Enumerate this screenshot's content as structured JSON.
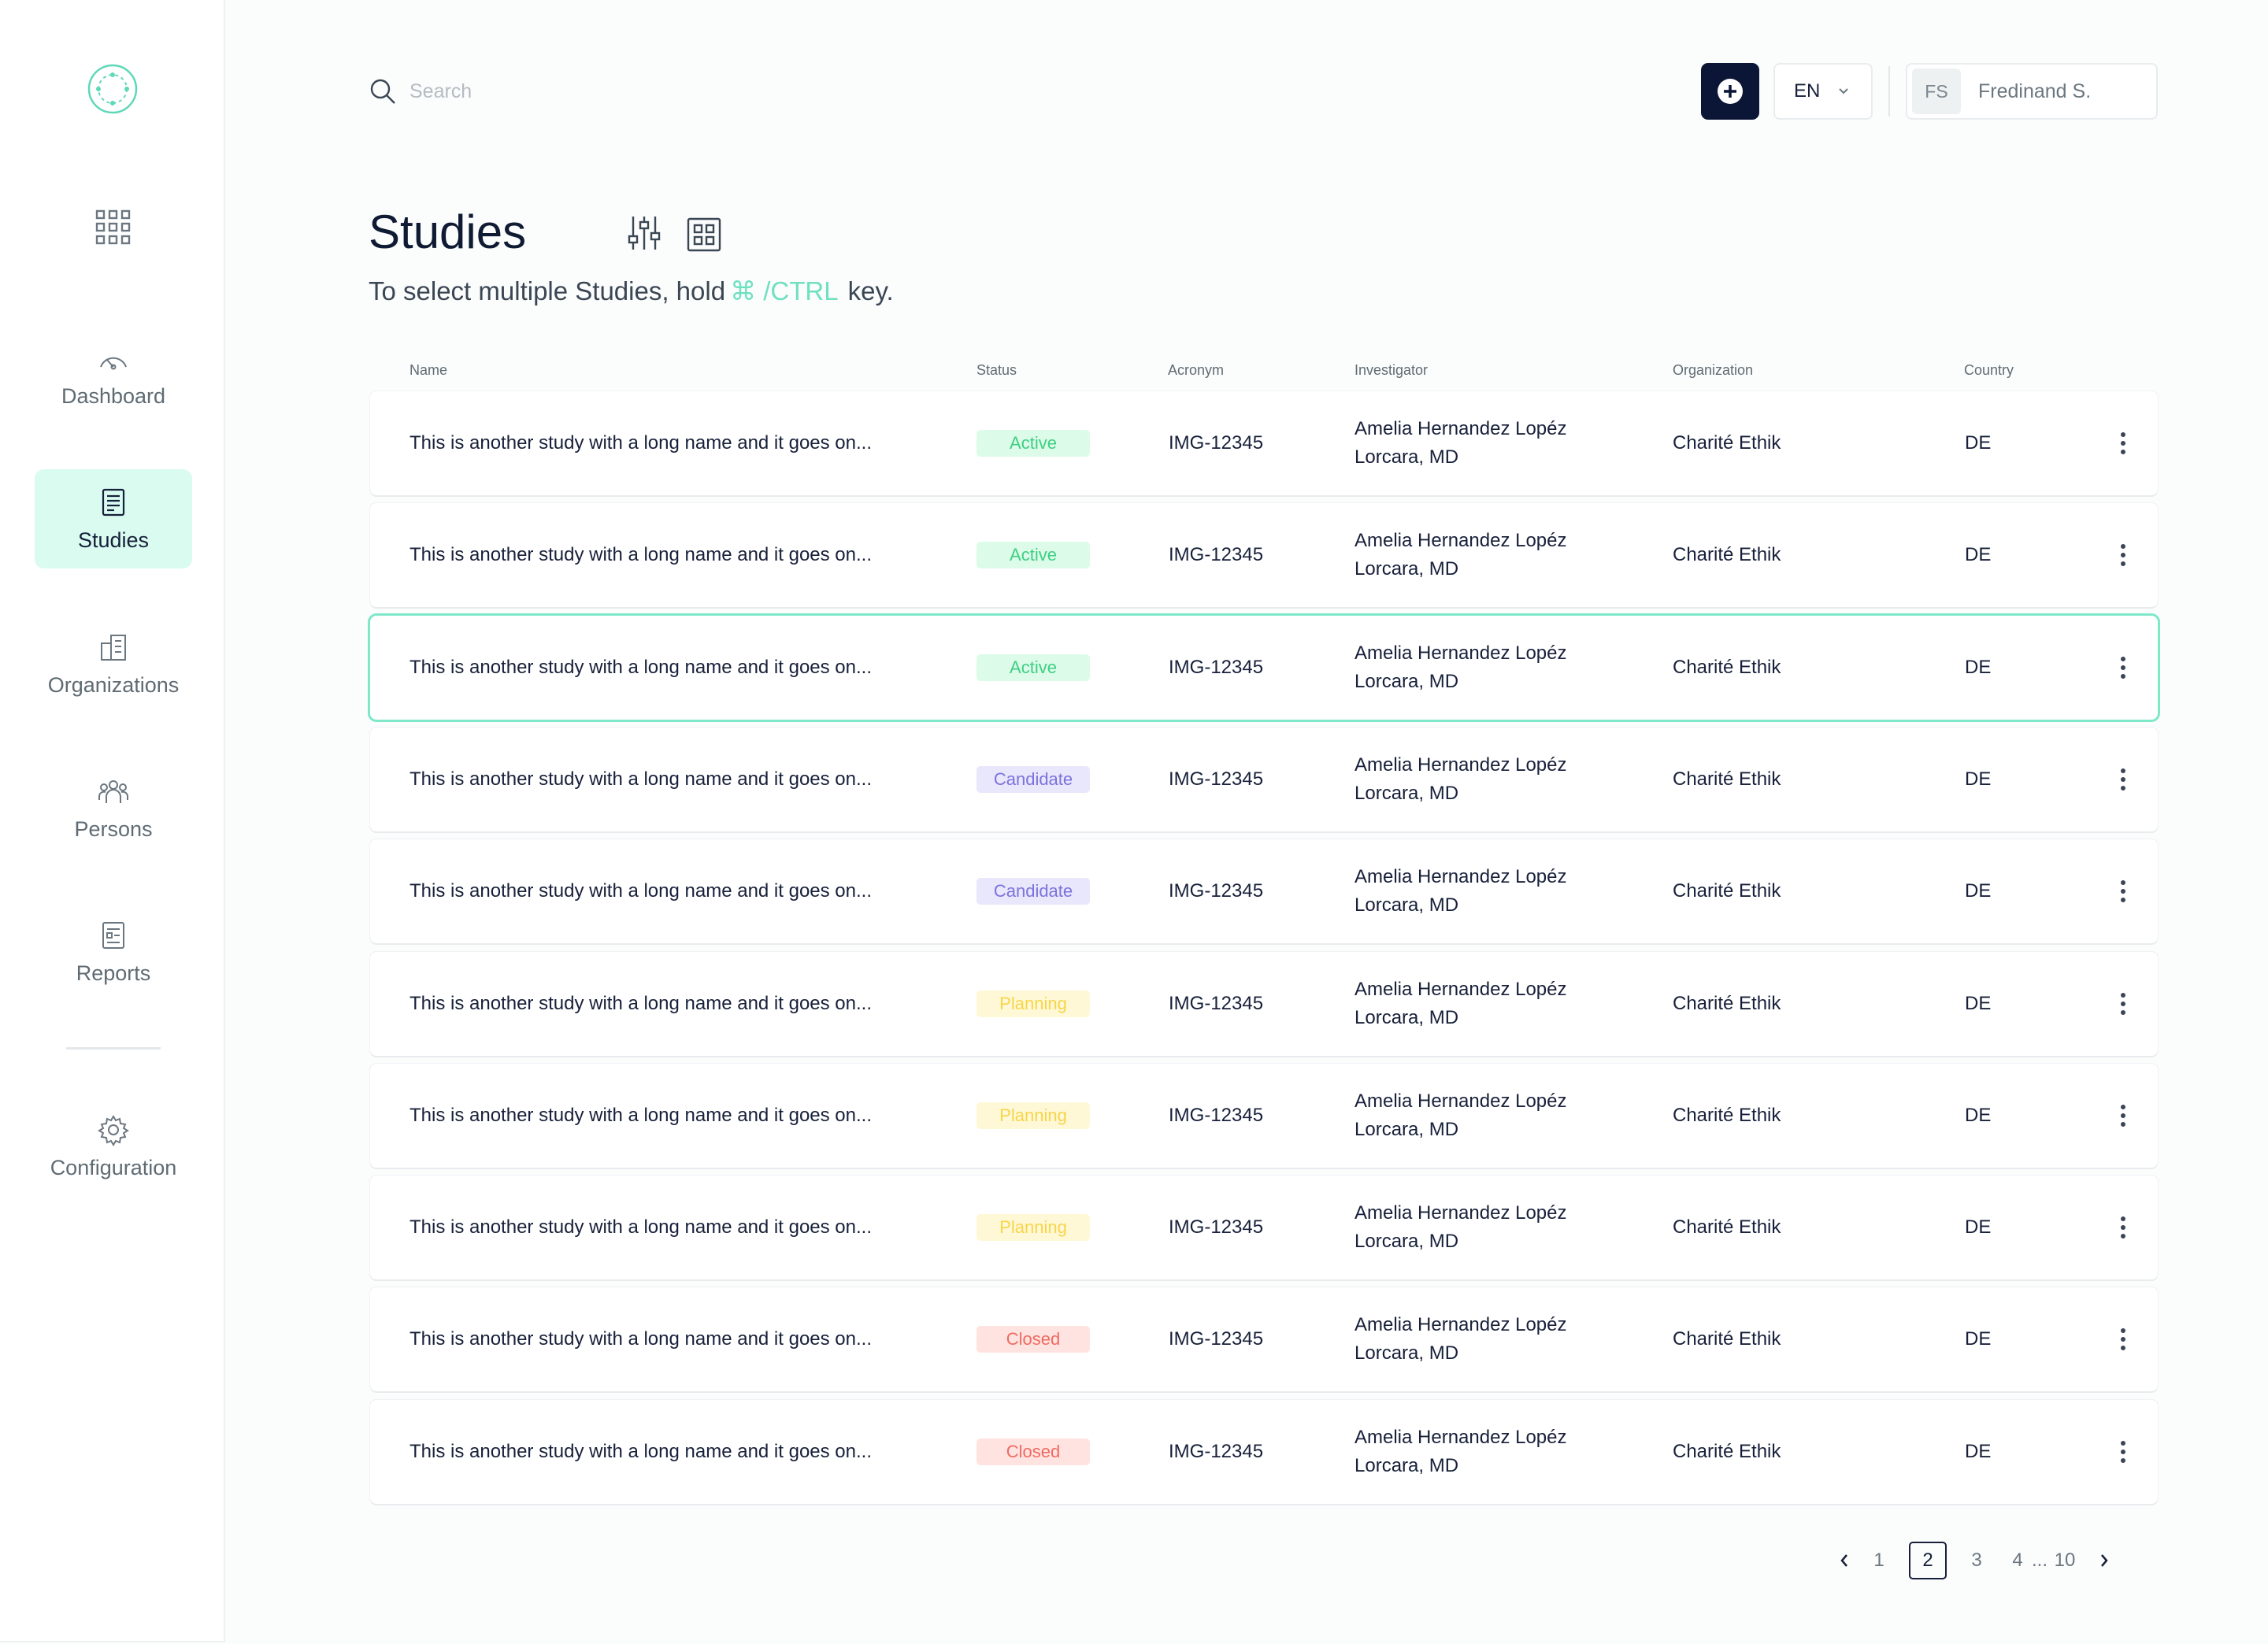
{
  "colors": {
    "accent": "#6fe0c0",
    "nav_active_bg": "#d9fbf0",
    "primary_dark": "#0b1535",
    "selected_border": "#7ee8c8"
  },
  "sidebar": {
    "logo_icon": "circular-network-icon",
    "apps_icon": "grid-dots-icon",
    "items": [
      {
        "label": "Dashboard",
        "icon": "gauge-icon",
        "active": false
      },
      {
        "label": "Studies",
        "icon": "document-icon",
        "active": true
      },
      {
        "label": "Organizations",
        "icon": "building-icon",
        "active": false
      },
      {
        "label": "Persons",
        "icon": "people-icon",
        "active": false
      },
      {
        "label": "Reports",
        "icon": "report-icon",
        "active": false
      },
      {
        "label": "Configuration",
        "icon": "gear-icon",
        "active": false
      }
    ]
  },
  "header": {
    "search_placeholder": "Search",
    "language": "EN",
    "user_initials": "FS",
    "user_name": "Fredinand S."
  },
  "page": {
    "title": "Studies",
    "hint_prefix": "To select multiple Studies, hold",
    "hint_key": "⌘ /CTRL",
    "hint_suffix": "key."
  },
  "table": {
    "columns": [
      "Name",
      "Status",
      "Acronym",
      "Investigator",
      "Organization",
      "Country"
    ],
    "status_styles": {
      "Active": {
        "bg": "#dcfbe9",
        "fg": "#3fcf84"
      },
      "Candidate": {
        "bg": "#e8e7fb",
        "fg": "#7b73dd"
      },
      "Planning": {
        "bg": "#fff8d6",
        "fg": "#f7d54a"
      },
      "Closed": {
        "bg": "#ffe3e1",
        "fg": "#ef6b61"
      }
    },
    "rows": [
      {
        "name": "This is another study with a long name and it goes on...",
        "status": "Active",
        "acronym": "IMG-12345",
        "investigator_line1": "Amelia Hernandez Lopéz",
        "investigator_line2": "Lorcara, MD",
        "organization": "Charité Ethik",
        "country": "DE",
        "selected": false
      },
      {
        "name": "This is another study with a long name and it goes on...",
        "status": "Active",
        "acronym": "IMG-12345",
        "investigator_line1": "Amelia Hernandez Lopéz",
        "investigator_line2": "Lorcara, MD",
        "organization": "Charité Ethik",
        "country": "DE",
        "selected": false
      },
      {
        "name": "This is another study with a long name and it goes on...",
        "status": "Active",
        "acronym": "IMG-12345",
        "investigator_line1": "Amelia Hernandez Lopéz",
        "investigator_line2": "Lorcara, MD",
        "organization": "Charité Ethik",
        "country": "DE",
        "selected": true
      },
      {
        "name": "This is another study with a long name and it goes on...",
        "status": "Candidate",
        "acronym": "IMG-12345",
        "investigator_line1": "Amelia Hernandez Lopéz",
        "investigator_line2": "Lorcara, MD",
        "organization": "Charité Ethik",
        "country": "DE",
        "selected": false
      },
      {
        "name": "This is another study with a long name and it goes on...",
        "status": "Candidate",
        "acronym": "IMG-12345",
        "investigator_line1": "Amelia Hernandez Lopéz",
        "investigator_line2": "Lorcara, MD",
        "organization": "Charité Ethik",
        "country": "DE",
        "selected": false
      },
      {
        "name": "This is another study with a long name and it goes on...",
        "status": "Planning",
        "acronym": "IMG-12345",
        "investigator_line1": "Amelia Hernandez Lopéz",
        "investigator_line2": "Lorcara, MD",
        "organization": "Charité Ethik",
        "country": "DE",
        "selected": false
      },
      {
        "name": "This is another study with a long name and it goes on...",
        "status": "Planning",
        "acronym": "IMG-12345",
        "investigator_line1": "Amelia Hernandez Lopéz",
        "investigator_line2": "Lorcara, MD",
        "organization": "Charité Ethik",
        "country": "DE",
        "selected": false
      },
      {
        "name": "This is another study with a long name and it goes on...",
        "status": "Planning",
        "acronym": "IMG-12345",
        "investigator_line1": "Amelia Hernandez Lopéz",
        "investigator_line2": "Lorcara, MD",
        "organization": "Charité Ethik",
        "country": "DE",
        "selected": false
      },
      {
        "name": "This is another study with a long name and it goes on...",
        "status": "Closed",
        "acronym": "IMG-12345",
        "investigator_line1": "Amelia Hernandez Lopéz",
        "investigator_line2": "Lorcara, MD",
        "organization": "Charité Ethik",
        "country": "DE",
        "selected": false
      },
      {
        "name": "This is another study with a long name and it goes on...",
        "status": "Closed",
        "acronym": "IMG-12345",
        "investigator_line1": "Amelia Hernandez Lopéz",
        "investigator_line2": "Lorcara, MD",
        "organization": "Charité Ethik",
        "country": "DE",
        "selected": false
      }
    ]
  },
  "pagination": {
    "pages": [
      "1",
      "2",
      "3",
      "4"
    ],
    "current": "2",
    "ellipsis": "...",
    "last": "10"
  }
}
